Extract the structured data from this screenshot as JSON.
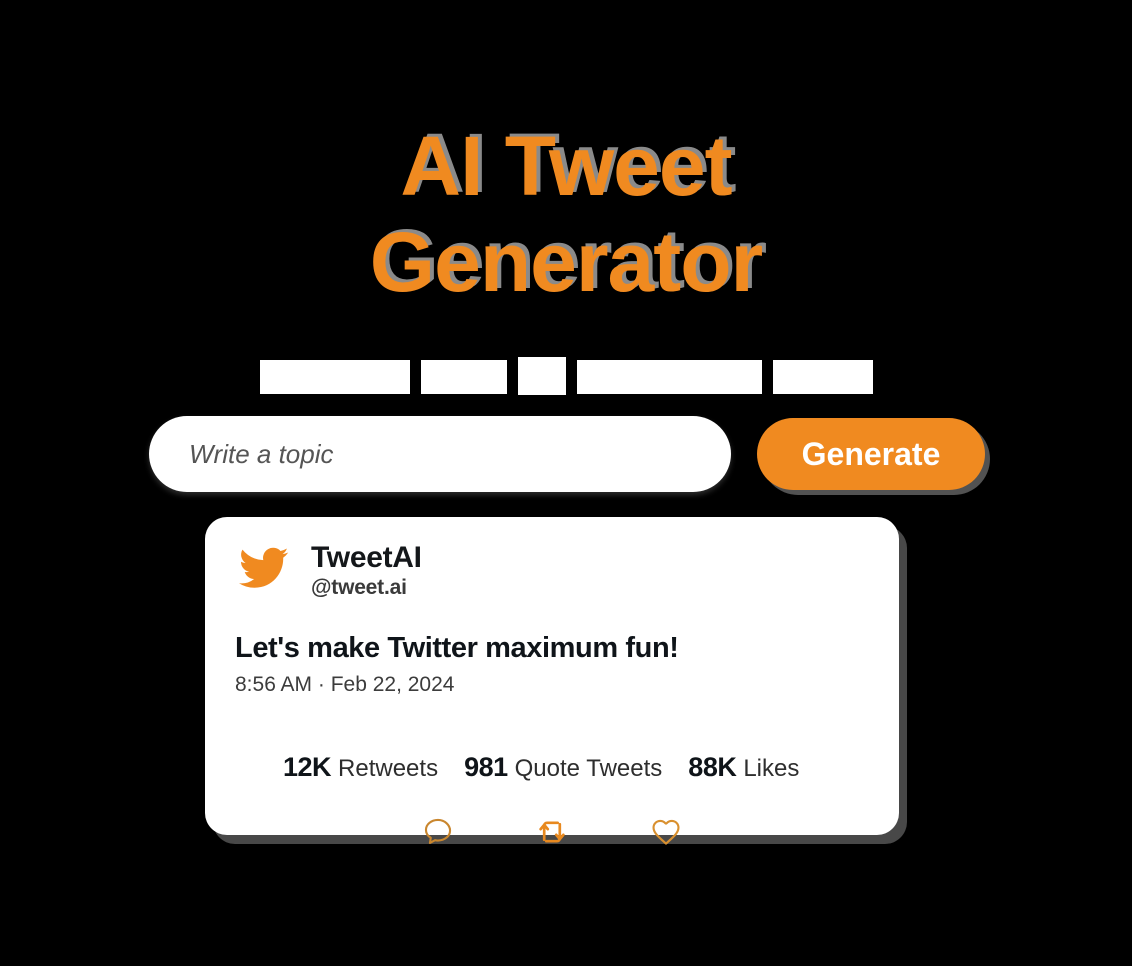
{
  "theme": {
    "background": "#000000",
    "accent_orange": "#F08A20",
    "card_background": "#ffffff",
    "title_shadow": "#8a8a8a"
  },
  "hero": {
    "title_line_1": "AI Tweet",
    "title_line_2": "Generator",
    "subtitle_obscured": true,
    "subtitle_block_count": 5
  },
  "search": {
    "placeholder": "Write a topic",
    "value": "",
    "generate_label": "Generate"
  },
  "tweet": {
    "avatar_icon": "twitter-bird-icon",
    "display_name": "TweetAI",
    "handle": "@tweet.ai",
    "text": "Let's make Twitter maximum fun!",
    "timestamp": "8:56 AM · Feb 22, 2024",
    "stats": [
      {
        "value": "12K",
        "label": "Retweets"
      },
      {
        "value": "981",
        "label": "Quote Tweets"
      },
      {
        "value": "88K",
        "label": "Likes"
      }
    ],
    "actions": [
      {
        "icon": "comment-icon"
      },
      {
        "icon": "retweet-icon"
      },
      {
        "icon": "heart-icon"
      }
    ]
  }
}
